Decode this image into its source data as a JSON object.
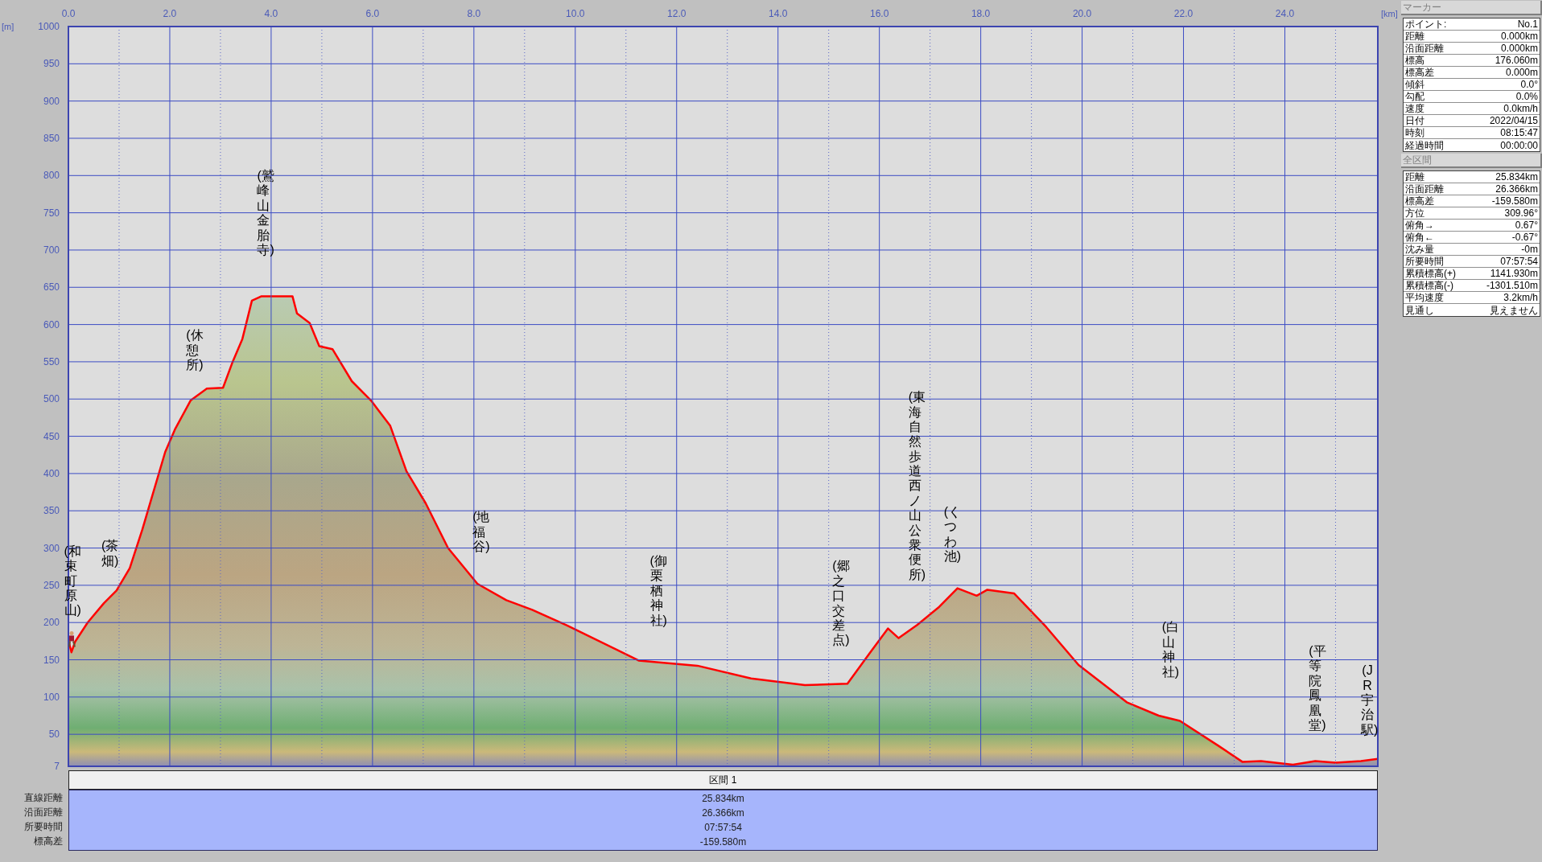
{
  "chart": {
    "y_unit_label": "[m]",
    "x_unit_label": "[km]",
    "chart_data": {
      "type": "area",
      "grid": true,
      "ref_lines": [
        {
          "axis": "x",
          "value": 1
        },
        {
          "axis": "x",
          "value": 3
        },
        {
          "axis": "x",
          "value": 5
        },
        {
          "axis": "x",
          "value": 7
        },
        {
          "axis": "x",
          "value": 9
        },
        {
          "axis": "x",
          "value": 11
        },
        {
          "axis": "x",
          "value": 13
        },
        {
          "axis": "x",
          "value": 15
        },
        {
          "axis": "x",
          "value": 17
        },
        {
          "axis": "x",
          "value": 19
        },
        {
          "axis": "x",
          "value": 21
        },
        {
          "axis": "x",
          "value": 23
        },
        {
          "axis": "x",
          "value": 25
        }
      ],
      "xlim": [
        0,
        25.834
      ],
      "ylim": [
        7,
        1000
      ],
      "xticks": [
        {
          "value": 0,
          "label": "0.0"
        },
        {
          "value": 2,
          "label": "2.0"
        },
        {
          "value": 4,
          "label": "4.0"
        },
        {
          "value": 6,
          "label": "6.0"
        },
        {
          "value": 8,
          "label": "8.0"
        },
        {
          "value": 10,
          "label": "10.0"
        },
        {
          "value": 12,
          "label": "12.0"
        },
        {
          "value": 14,
          "label": "14.0"
        },
        {
          "value": 16,
          "label": "16.0"
        },
        {
          "value": 18,
          "label": "18.0"
        },
        {
          "value": 20,
          "label": "20.0"
        },
        {
          "value": 22,
          "label": "22.0"
        },
        {
          "value": 24,
          "label": "24.0"
        }
      ],
      "yticks": [
        7,
        50,
        100,
        150,
        200,
        250,
        300,
        350,
        400,
        450,
        500,
        550,
        600,
        650,
        700,
        750,
        800,
        850,
        900,
        950,
        1000
      ],
      "x": [
        0,
        0.06,
        0.13,
        0.38,
        0.7,
        0.95,
        1.21,
        1.46,
        1.65,
        1.91,
        2.1,
        2.41,
        2.73,
        3.05,
        3.24,
        3.43,
        3.62,
        3.81,
        4.42,
        4.51,
        4.76,
        4.95,
        5.21,
        5.59,
        5.97,
        6.35,
        6.67,
        7.05,
        7.49,
        8.07,
        8.64,
        9.15,
        9.84,
        11.25,
        12.41,
        13.47,
        14.53,
        15.37,
        15.8,
        16.17,
        16.38,
        16.75,
        17.18,
        17.54,
        17.92,
        18.13,
        18.66,
        19.29,
        19.93,
        20.88,
        21.51,
        21.93,
        22.68,
        23.16,
        23.53,
        24.16,
        24.6,
        25.0,
        25.5,
        25.834
      ],
      "series": [
        {
          "color": "#ff0000",
          "values": [
            176,
            160,
            174,
            200,
            226,
            243,
            273,
            325,
            369,
            429,
            459,
            498,
            514,
            515,
            550,
            580,
            632,
            638,
            638,
            615,
            602,
            571,
            567,
            524,
            498,
            464,
            403,
            360,
            300,
            252,
            230,
            217,
            196,
            149,
            142,
            125,
            116,
            118,
            158,
            192,
            179,
            197,
            221,
            246,
            236,
            244,
            239,
            194,
            143,
            93,
            75,
            68,
            35,
            13,
            14,
            9,
            14,
            12,
            14,
            17
          ]
        }
      ],
      "annotations": [
        "(和束町原山)",
        "(茶畑)",
        "(休憩所)",
        "(鷲峰山金胎寺)",
        "(地福谷)",
        "(御栗栖神社)",
        "(郷之口交差点)",
        "(東海自然歩道西ノ山公衆便所)",
        "(くつわ池)",
        "(白山神社)",
        "(平等院鳳凰堂)",
        "(JR宇治駅)"
      ]
    }
  },
  "section_table": {
    "header": "区間 1",
    "rows": [
      {
        "label": "直線距離",
        "value": "25.834km"
      },
      {
        "label": "沿面距離",
        "value": "26.366km"
      },
      {
        "label": "所要時間",
        "value": "07:57:54"
      },
      {
        "label": "標高差",
        "value": "-159.580m"
      }
    ]
  },
  "side_panel": {
    "sections": [
      {
        "title": "マーカー",
        "rows": [
          {
            "label": "ポイント:",
            "value": "No.1"
          },
          {
            "label": "距離",
            "value": "0.000km"
          },
          {
            "label": "沿面距離",
            "value": "0.000km"
          },
          {
            "label": "標高",
            "value": "176.060m"
          },
          {
            "label": "標高差",
            "value": "0.000m"
          },
          {
            "label": "傾斜",
            "value": "0.0°"
          },
          {
            "label": "勾配",
            "value": "0.0%"
          },
          {
            "label": "速度",
            "value": "0.0km/h"
          },
          {
            "label": "日付",
            "value": "2022/04/15"
          },
          {
            "label": "時刻",
            "value": "08:15:47"
          },
          {
            "label": "経過時間",
            "value": "00:00:00"
          }
        ]
      },
      {
        "title": "全区間",
        "rows": [
          {
            "label": "距離",
            "value": "25.834km"
          },
          {
            "label": "沿面距離",
            "value": "26.366km"
          },
          {
            "label": "標高差",
            "value": "-159.580m"
          },
          {
            "label": "方位",
            "value": "309.96°"
          },
          {
            "label": "俯角→",
            "value": "0.67°"
          },
          {
            "label": "俯角←",
            "value": "-0.67°"
          },
          {
            "label": "沈み量",
            "value": "-0m"
          },
          {
            "label": "所要時間",
            "value": "07:57:54"
          },
          {
            "label": "累積標高(+)",
            "value": "1141.930m"
          },
          {
            "label": "累積標高(-)",
            "value": "-1301.510m"
          },
          {
            "label": "平均速度",
            "value": "3.2km/h"
          },
          {
            "label": "見通し",
            "value": "見えません"
          }
        ]
      }
    ]
  }
}
